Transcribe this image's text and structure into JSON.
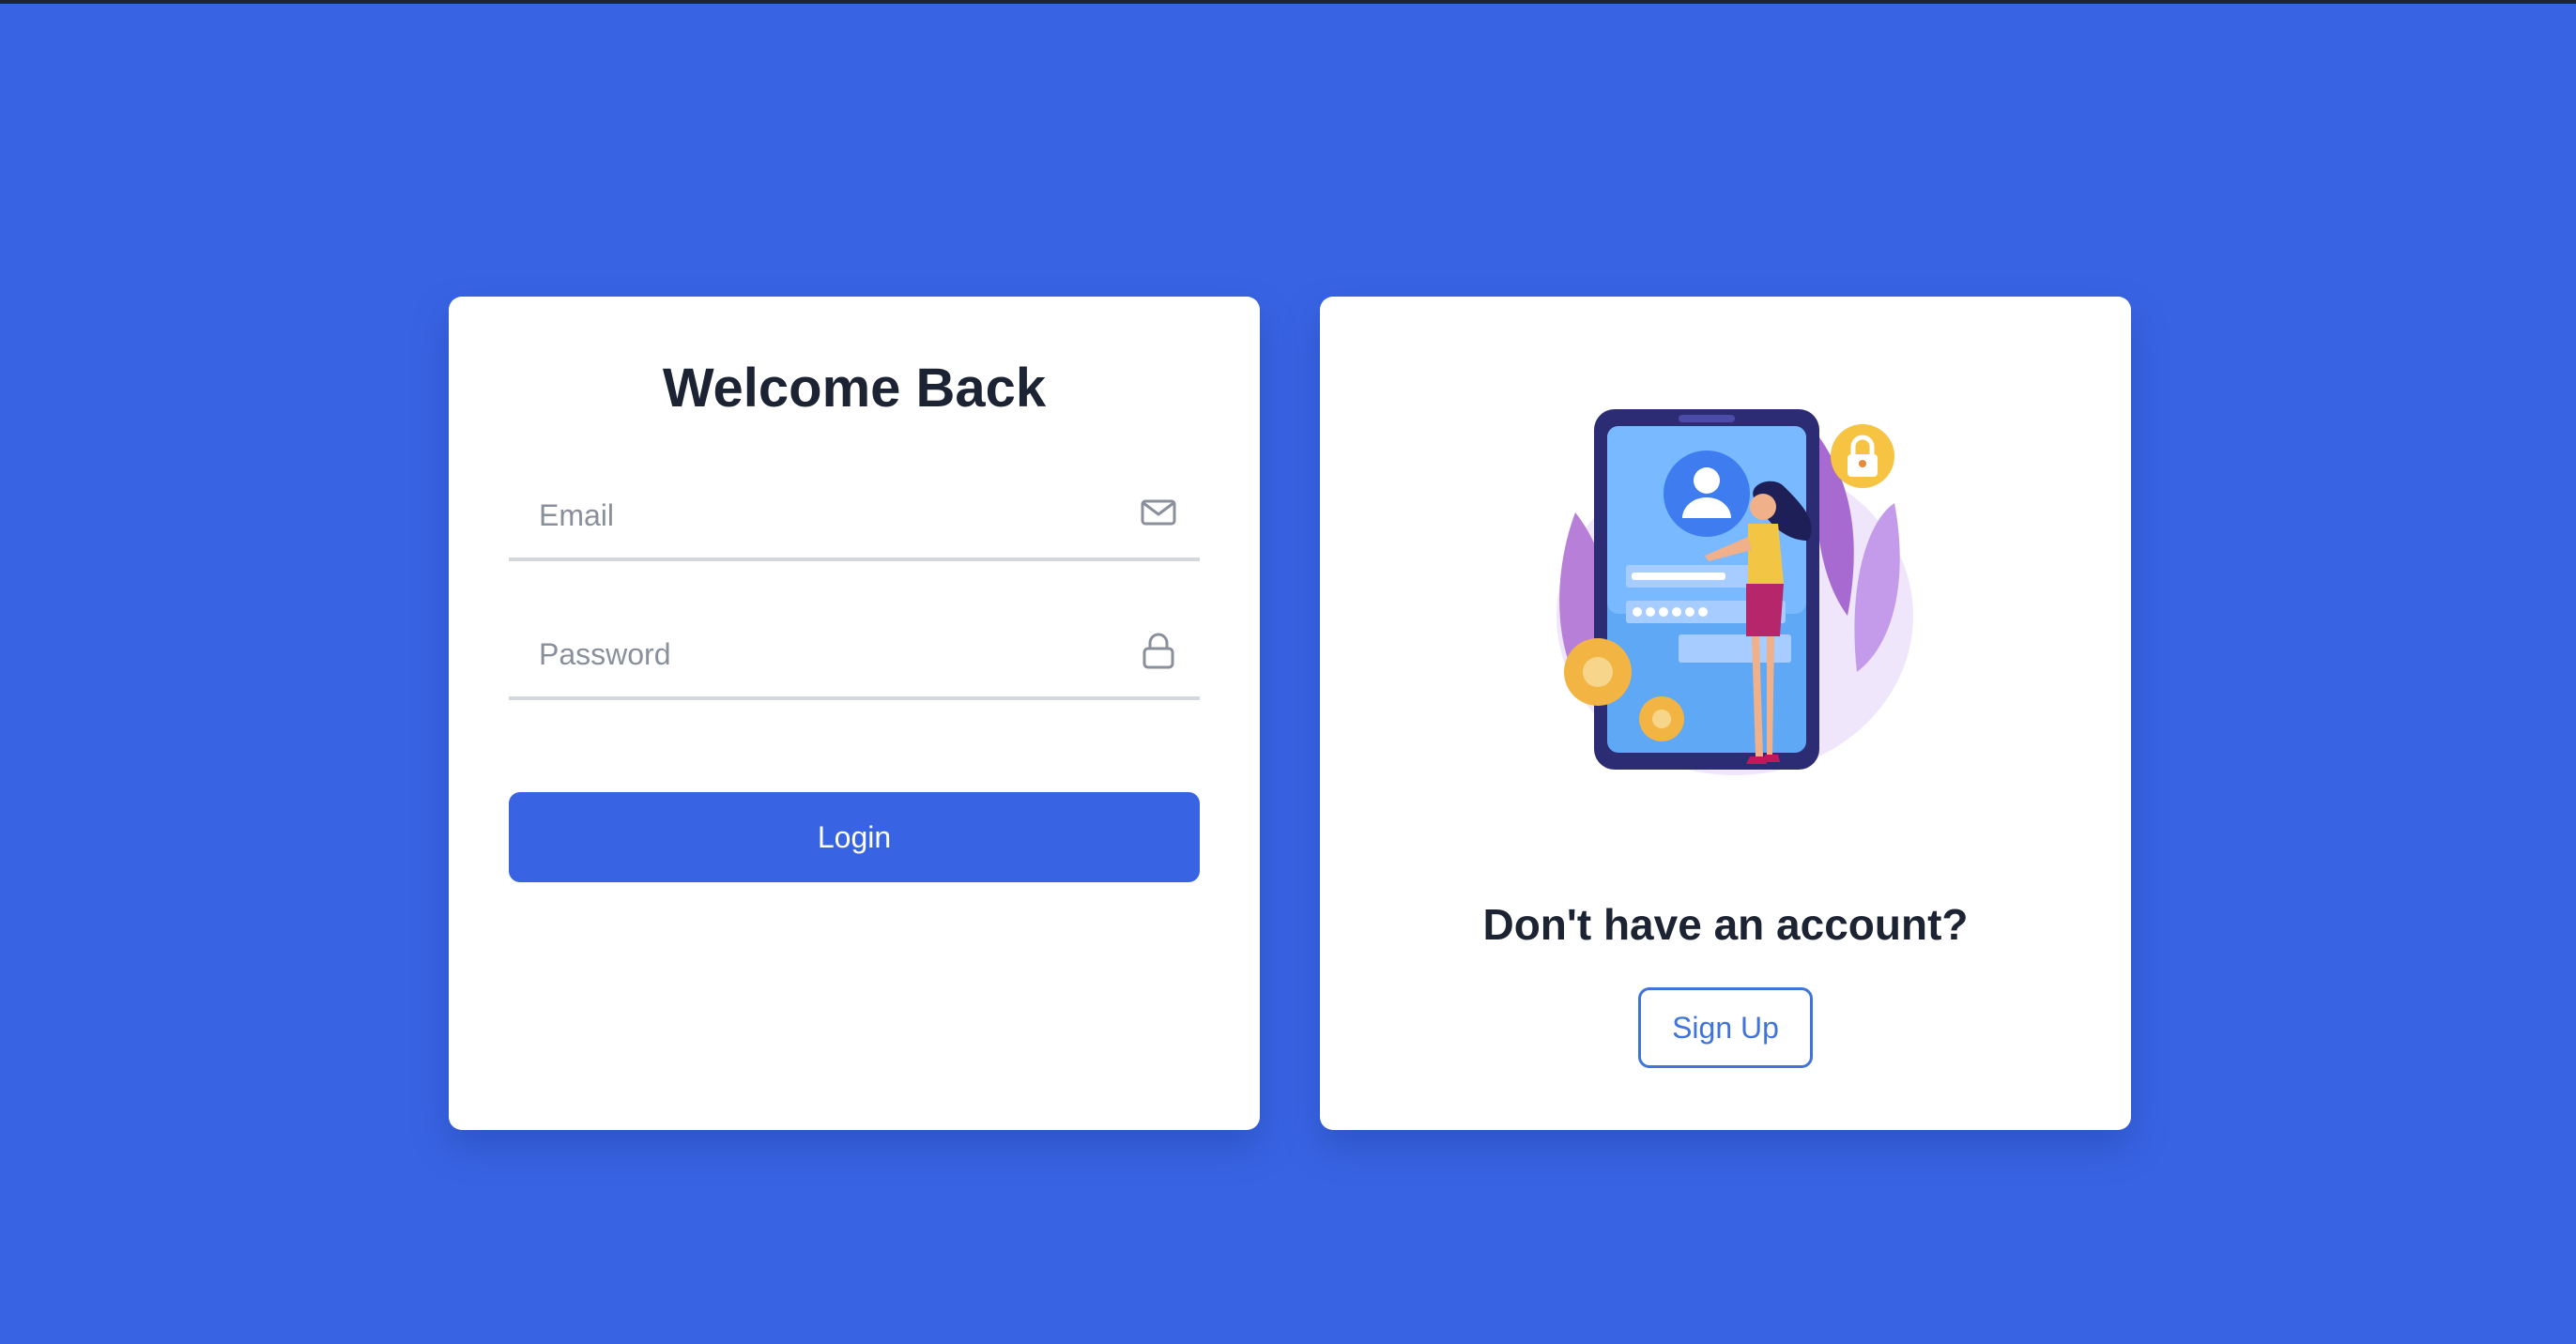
{
  "login_card": {
    "title": "Welcome Back",
    "email_placeholder": "Email",
    "email_value": "",
    "password_placeholder": "Password",
    "password_value": "",
    "login_label": "Login"
  },
  "signup_card": {
    "heading": "Don't have an account?",
    "signup_label": "Sign Up"
  },
  "icons": {
    "email": "mail-icon",
    "password": "lock-icon"
  },
  "colors": {
    "background": "#3864e4",
    "primary_button": "#3864e4",
    "signup_outline": "#3f74dc",
    "text_dark": "#1c2333",
    "placeholder": "#8a909b"
  }
}
